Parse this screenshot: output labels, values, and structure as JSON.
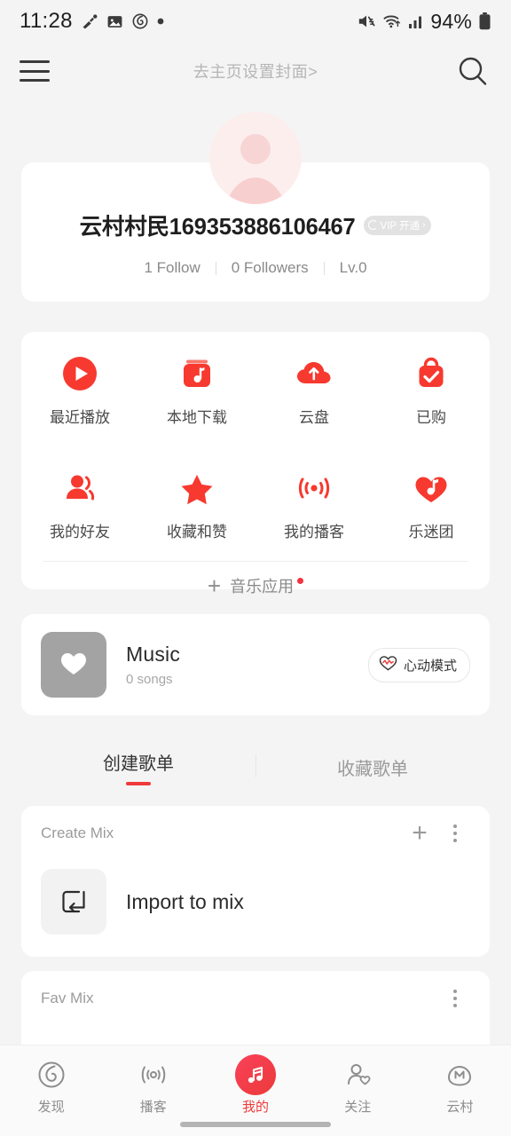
{
  "status_bar": {
    "time": "11:28",
    "battery_percent": "94%",
    "left_icons": [
      "vpn-key-icon",
      "image-icon",
      "netease-music-icon",
      "dot-icon"
    ],
    "right_icons": [
      "mute-icon",
      "wifi-icon",
      "signal-bars-icon",
      "battery-icon"
    ]
  },
  "top_bar": {
    "menu_icon": "hamburger-menu-icon",
    "title": "去主页设置封面>",
    "search_icon": "search-icon"
  },
  "profile": {
    "avatar": "default-user-avatar",
    "username": "云村村民169353886106467",
    "vip_badge": {
      "label": "VIP 开通",
      "arrow": "›"
    },
    "stats": [
      {
        "id": "follow",
        "text": "1 Follow"
      },
      {
        "id": "followers",
        "text": "0 Followers"
      },
      {
        "id": "level",
        "text": "Lv.0"
      }
    ]
  },
  "entries": {
    "items": [
      {
        "icon": "play-circle-icon",
        "label": "最近播放"
      },
      {
        "icon": "local-download-icon",
        "label": "本地下载"
      },
      {
        "icon": "cloud-upload-icon",
        "label": "云盘"
      },
      {
        "icon": "purchased-bag-icon",
        "label": "已购"
      },
      {
        "icon": "friends-icon",
        "label": "我的好友"
      },
      {
        "icon": "star-icon",
        "label": "收藏和赞"
      },
      {
        "icon": "podcast-icon",
        "label": "我的播客"
      },
      {
        "icon": "fan-club-heart-icon",
        "label": "乐迷团"
      }
    ],
    "music_apps": {
      "plus": "+",
      "label": "音乐应用",
      "badge_dot": true
    }
  },
  "favorites_card": {
    "thumb_icon": "heart-filled-icon",
    "title": "Music",
    "subtitle": "0 songs",
    "heart_mode_button": {
      "icon": "heartbeat-icon",
      "label": "心动模式"
    }
  },
  "playlist_tabs": [
    {
      "label": "创建歌单",
      "active": true
    },
    {
      "label": "收藏歌单",
      "active": false
    }
  ],
  "playlists": [
    {
      "title": "Create Mix",
      "plus_icon": "plus-icon",
      "more_icon": "more-vertical-icon",
      "row": {
        "icon": "import-arrow-icon",
        "label": "Import to mix"
      }
    },
    {
      "title": "Fav Mix",
      "more_icon": "more-vertical-icon"
    }
  ],
  "bottom_nav": [
    {
      "icon": "discover-icon",
      "label": "发现",
      "active": false
    },
    {
      "icon": "podcast-wave-icon",
      "label": "播客",
      "active": false
    },
    {
      "icon": "my-music-icon",
      "label": "我的",
      "active": true
    },
    {
      "icon": "follow-person-icon",
      "label": "关注",
      "active": false
    },
    {
      "icon": "cloud-village-icon",
      "label": "云村",
      "active": false
    }
  ],
  "colors": {
    "accent_red": "#ee3a3a",
    "badge_red": "#f5333f",
    "background": "#f4f4f4",
    "card": "#ffffff"
  }
}
